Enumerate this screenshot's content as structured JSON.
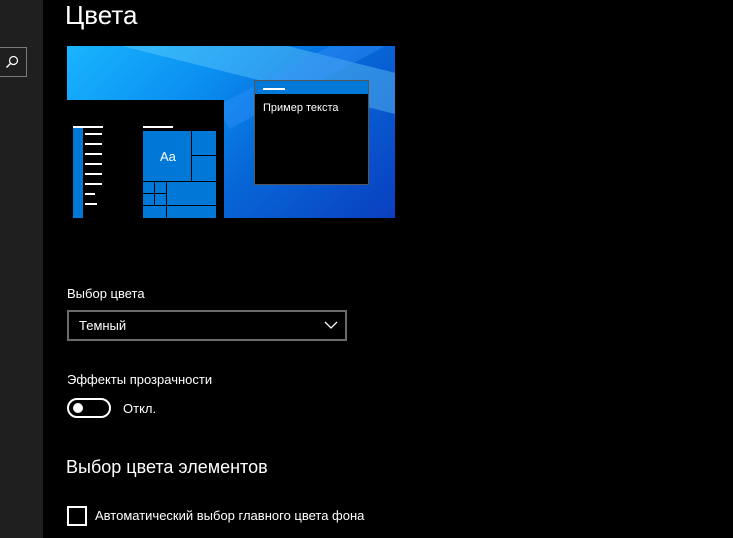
{
  "page": {
    "title": "Цвета"
  },
  "preview": {
    "sample_text": "Пример текста",
    "tile_text": "Aa"
  },
  "color_choice": {
    "label": "Выбор цвета",
    "value": "Темный"
  },
  "transparency": {
    "label": "Эффекты прозрачности",
    "state_label": "Откл.",
    "on": false
  },
  "accent": {
    "heading": "Выбор цвета элементов",
    "auto_label": "Автоматический выбор главного цвета фона",
    "auto_checked": false
  },
  "icons": {
    "search": "search-icon",
    "dropdown": "chevron-down-icon"
  },
  "colors": {
    "accent": "#0078d7",
    "background": "#000000",
    "sidebar": "#1f1f1f"
  }
}
